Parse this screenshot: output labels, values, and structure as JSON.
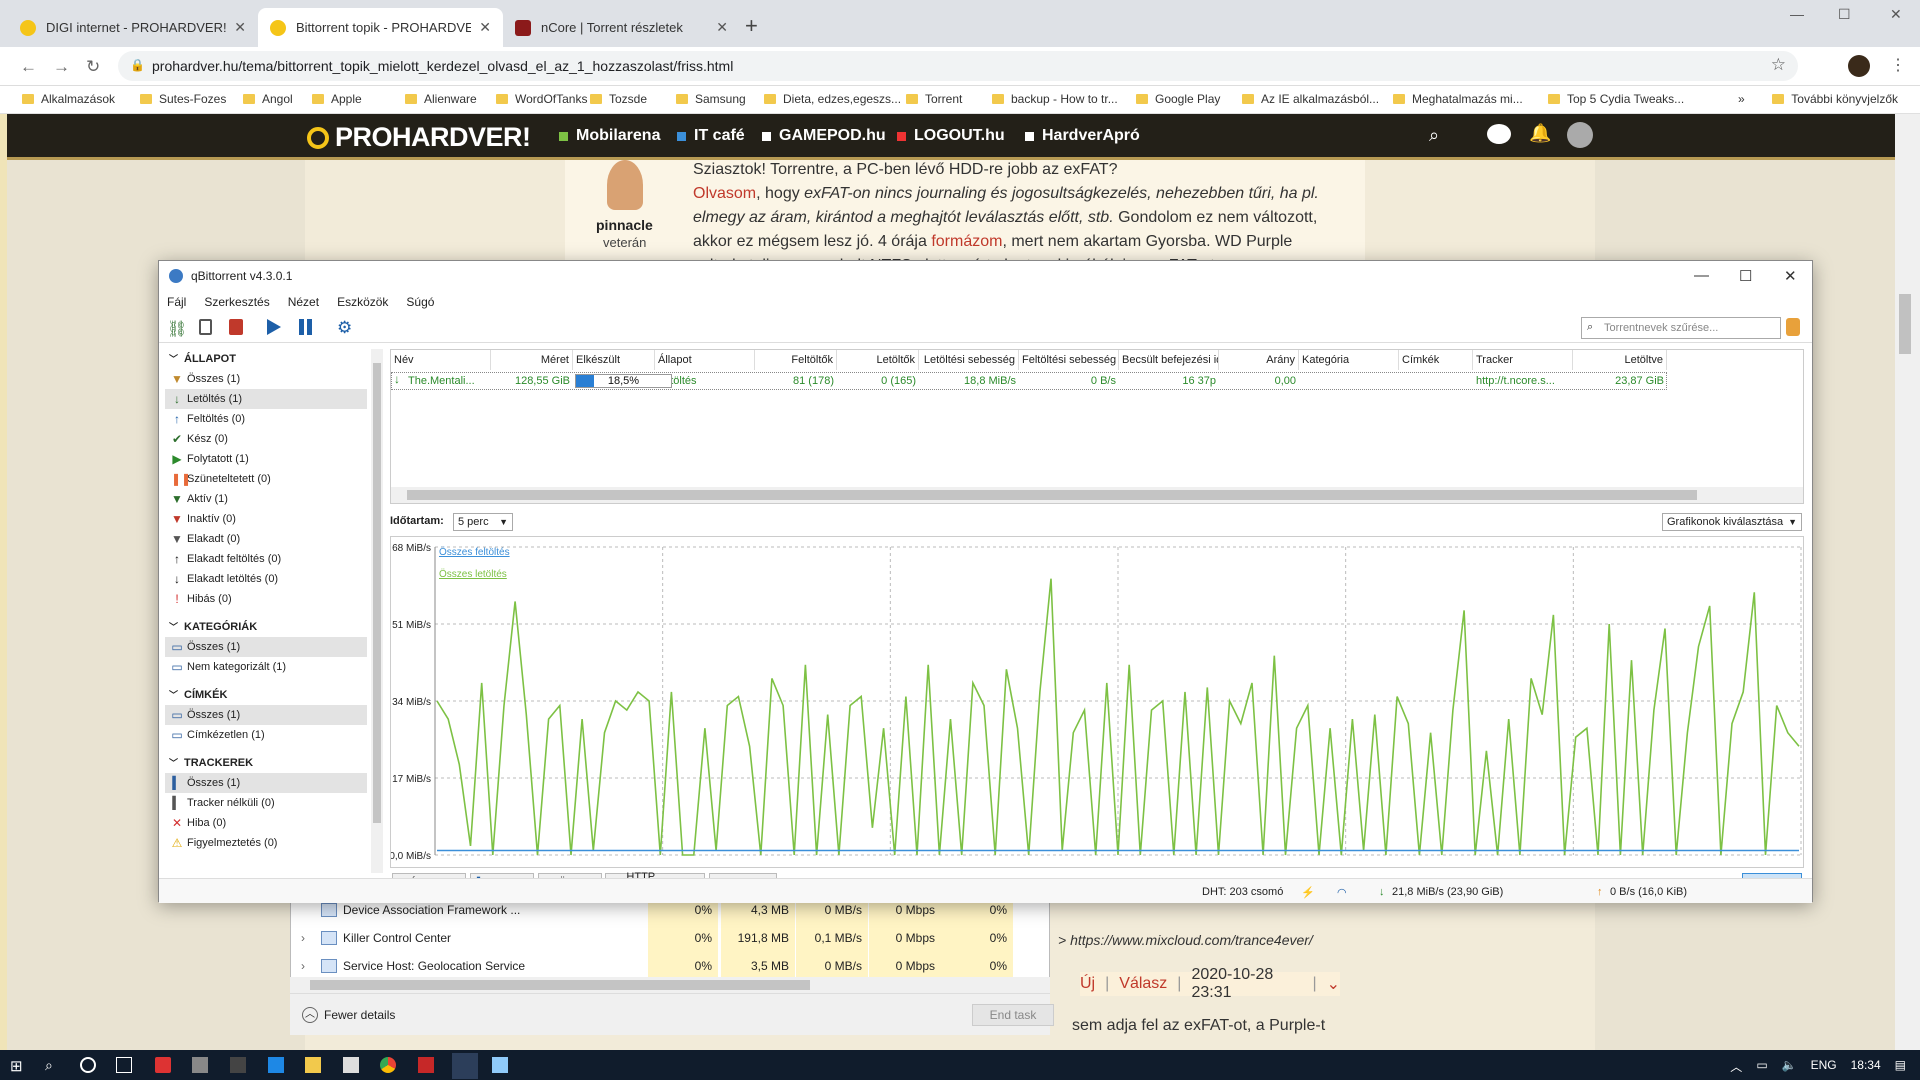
{
  "browser": {
    "tabs": [
      {
        "label": "DIGI internet - PROHARDVER! Ho"
      },
      {
        "label": "Bittorrent topik - PROHARDVER!"
      },
      {
        "label": "nCore | Torrent részletek"
      }
    ],
    "url": "prohardver.hu/tema/bittorrent_topik_mielott_kerdezel_olvasd_el_az_1_hozzaszolast/friss.html",
    "bookmarks": [
      "Alkalmazások",
      "Sutes-Fozes",
      "Angol",
      "Apple",
      "Alienware",
      "WordOfTanks",
      "Tozsde",
      "Samsung",
      "Dieta, edzes,egeszs...",
      "Torrent",
      "backup - How to tr...",
      "Google Play",
      "Az IE alkalmazásból...",
      "Meghatalmazás mi...",
      "Top 5 Cydia Tweaks...",
      "»",
      "További könyvjelzők"
    ]
  },
  "site": {
    "logo": "PROHARDVER!",
    "nav": [
      "Mobilarena",
      "IT café",
      "GAMEPOD.hu",
      "LOGOUT.hu",
      "HardverApró"
    ],
    "post": {
      "line0": "Sziasztok! Torrentre, a PC-ben lévő HDD-re jobb az exFAT?",
      "line1a": "Olvasom",
      "line1b": ", hogy ",
      "line1c": "exFAT-on nincs journaling és jogosultságkezelés, nehezebben tűri, ha pl.",
      "line2": "elmegy az áram, kirántod a meghajtót leválasztás előtt, stb.",
      "line2b": " Gondolom ez nem változott,",
      "line3a": "akkor ez mégsem lesz jó. 4 órája ",
      "line3b": "formázom",
      "line3c": ", mert nem akartam Gyorsba. WD Purple",
      "line4": "volt, de teljesen meghalt NTFS alatt, ezért akartam kipróbálni az exFAT-ot.",
      "user": "pinnacle",
      "rank": "veterán",
      "mix": "> https://www.mixcloud.com/trance4ever/",
      "new": "Új",
      "reply": "Válasz",
      "date": "2020-10-28 23:31",
      "bottom": "sem adja fel az exFAT-ot, a Purple-t"
    }
  },
  "taskmgr": {
    "rows": [
      {
        "name": "Device Association Framework ...",
        "cpu": "0%",
        "mem": "4,3 MB",
        "disk": "0 MB/s",
        "net": "0 Mbps",
        "gpu": "0%"
      },
      {
        "name": "Killer Control Center",
        "cpu": "0%",
        "mem": "191,8 MB",
        "disk": "0,1 MB/s",
        "net": "0 Mbps",
        "gpu": "0%"
      },
      {
        "name": "Service Host: Geolocation Service",
        "cpu": "0%",
        "mem": "3,5 MB",
        "disk": "0 MB/s",
        "net": "0 Mbps",
        "gpu": "0%"
      }
    ],
    "fewer": "Fewer details",
    "endtask": "End task"
  },
  "qbt": {
    "title": "qBittorrent v4.3.0.1",
    "menu": [
      "Fájl",
      "Szerkesztés",
      "Nézet",
      "Eszközök",
      "Súgó"
    ],
    "filter_placeholder": "Torrentnevek szűrése...",
    "sidebar": {
      "status_header": "ÁLLAPOT",
      "status": [
        "Összes (1)",
        "Letöltés (1)",
        "Feltöltés (0)",
        "Kész (0)",
        "Folytatott (1)",
        "Szüneteltetett (0)",
        "Aktív (1)",
        "Inaktív (0)",
        "Elakadt (0)",
        "Elakadt feltöltés (0)",
        "Elakadt letöltés (0)",
        "Hibás (0)"
      ],
      "cat_header": "KATEGÓRIÁK",
      "cats": [
        "Összes (1)",
        "Nem kategorizált (1)"
      ],
      "tag_header": "CÍMKÉK",
      "tags": [
        "Összes (1)",
        "Címkézetlen (1)"
      ],
      "tracker_header": "TRACKEREK",
      "trackers": [
        "Összes (1)",
        "Tracker nélküli (0)",
        "Hiba (0)",
        "Figyelmeztetés (0)"
      ]
    },
    "columns": [
      "Név",
      "Méret",
      "Elkészült",
      "Állapot",
      "Feltöltők",
      "Letöltők",
      "Letöltési sebesség",
      "Feltöltési sebesség",
      "Becsült befejezési idő",
      "Arány",
      "Kategória",
      "Címkék",
      "Tracker",
      "Letöltve"
    ],
    "row": {
      "name": "The.Mentali...",
      "size": "128,55 GiB",
      "progress": "18,5%",
      "progress_value": 0.185,
      "state": "Letöltés",
      "seeds": "81 (178)",
      "peers": "0 (165)",
      "dl": "18,8 MiB/s",
      "ul": "0 B/s",
      "eta": "16 37p",
      "ratio": "0,00",
      "category": "",
      "tags": "",
      "tracker": "http://t.ncore.s...",
      "downloaded": "23,87 GiB"
    },
    "period_label": "Időtartam:",
    "period": "5 perc",
    "graph_select": "Grafikonok kiválasztása",
    "legend": [
      "Összes feltöltés",
      "Összes letöltés"
    ],
    "tabs": [
      "Általános",
      "Trackerek",
      "Ügyfelek",
      "HTTP Források",
      "Tartalom"
    ],
    "speed_tab": "Sebesség",
    "status": {
      "dht": "DHT: 203 csomó",
      "dl": "21,8 MiB/s (23,90 GiB)",
      "ul": "0 B/s (16,0 KiB)"
    }
  },
  "chart_data": {
    "type": "line",
    "ylabel": "",
    "yticks": [
      "0,0 MiB/s",
      "17 MiB/s",
      "34 MiB/s",
      "51 MiB/s",
      "68 MiB/s"
    ],
    "ylim": [
      0,
      68
    ],
    "series": [
      {
        "name": "Összes letöltés",
        "color": "#7dc144",
        "values": [
          34,
          30,
          20,
          2,
          38,
          0,
          33,
          56,
          31,
          0,
          30,
          33,
          0,
          30,
          1,
          27,
          34,
          32,
          36,
          34,
          0,
          36,
          0,
          0,
          28,
          1,
          33,
          35,
          24,
          0,
          39,
          33,
          0,
          42,
          0,
          31,
          0,
          33,
          35,
          6,
          28,
          0,
          35,
          0,
          42,
          0,
          30,
          0,
          38,
          33,
          0,
          41,
          28,
          0,
          36,
          61,
          1,
          27,
          32,
          0,
          38,
          0,
          42,
          0,
          32,
          34,
          0,
          36,
          0,
          37,
          0,
          34,
          29,
          38,
          0,
          44,
          0,
          28,
          33,
          0,
          28,
          0,
          30,
          1,
          31,
          0,
          35,
          29,
          0,
          27,
          0,
          32,
          54,
          0,
          23,
          0,
          30,
          0,
          39,
          31,
          53,
          0,
          26,
          28,
          0,
          51,
          0,
          43,
          0,
          32,
          50,
          0,
          27,
          46,
          55,
          0,
          29,
          36,
          58,
          0,
          33,
          27,
          24
        ]
      },
      {
        "name": "Összes feltöltés",
        "color": "#3b8fd9",
        "values": [
          1,
          1,
          1,
          1,
          1,
          1,
          1,
          1,
          1,
          1,
          1,
          1,
          1,
          1,
          1,
          1,
          1,
          1,
          1,
          1,
          1,
          1,
          1,
          1,
          1,
          1,
          1,
          1,
          1,
          1,
          1,
          1,
          1,
          1,
          1,
          1,
          1,
          1,
          1,
          1,
          1,
          1,
          1,
          1,
          1,
          1,
          1,
          1,
          1,
          1,
          1,
          1,
          1,
          1,
          1,
          1,
          1,
          1,
          1,
          1,
          1,
          1,
          1,
          1,
          1,
          1,
          1,
          1,
          1,
          1,
          1,
          1,
          1,
          1,
          1,
          1,
          1,
          1,
          1,
          1,
          1,
          1,
          1,
          1,
          1,
          1,
          1,
          1,
          1,
          1,
          1,
          1,
          1,
          1,
          1,
          1,
          1,
          1,
          1,
          1,
          1,
          1,
          1,
          1,
          1,
          1,
          1,
          1,
          1,
          1,
          1,
          1,
          1,
          1,
          1,
          1,
          1,
          1,
          1,
          1,
          1,
          1
        ]
      }
    ]
  },
  "taskbar": {
    "lang": "ENG",
    "time": "18:34"
  }
}
